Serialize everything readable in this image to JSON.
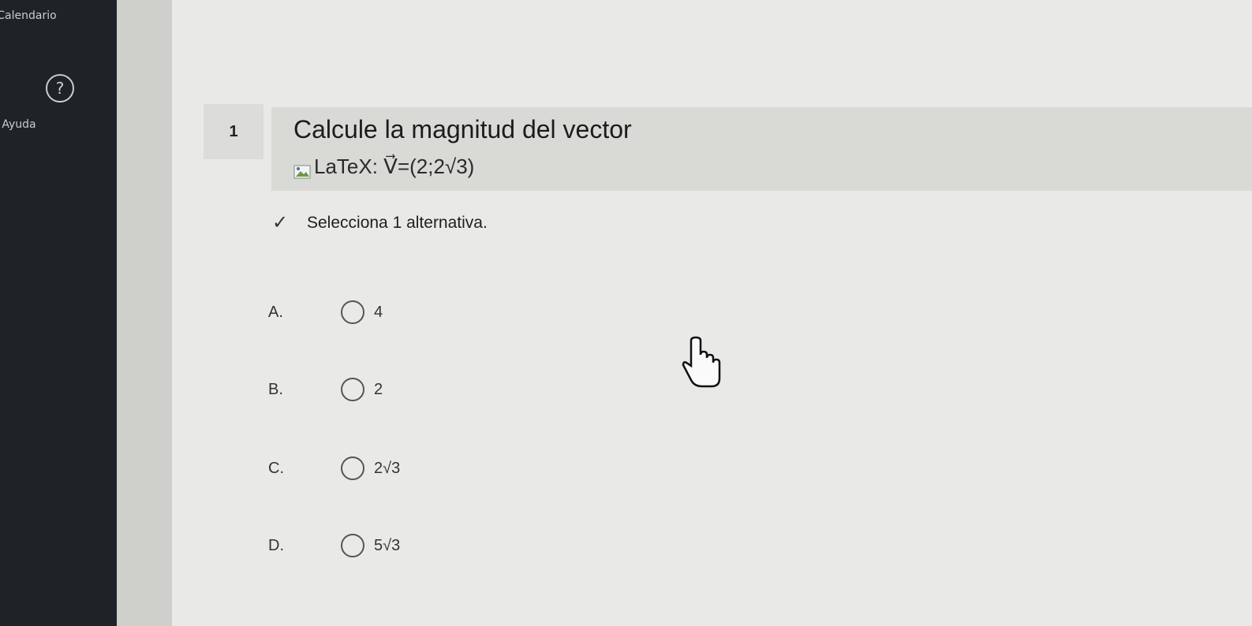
{
  "sidebar": {
    "calendar_label": "Calendario",
    "help_label": "Ayuda",
    "help_icon_glyph": "?"
  },
  "question": {
    "number": "1",
    "stem": "Calcule la magnitud del vector",
    "latex_alt": "LaTeX: V⃗=(2;2√3)",
    "instruction": "Selecciona 1 alternativa."
  },
  "options": [
    {
      "letter": "A.",
      "value": "4"
    },
    {
      "letter": "B.",
      "value": "2"
    },
    {
      "letter": "C.",
      "value": "2√3"
    },
    {
      "letter": "D.",
      "value": "5√3"
    }
  ],
  "colors": {
    "sidebar_bg": "#1f2328",
    "content_bg": "#e9e9e7",
    "stem_bg": "#d9d9d6"
  }
}
